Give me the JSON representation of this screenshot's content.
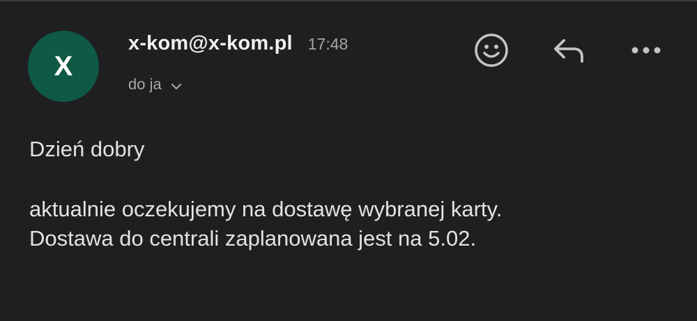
{
  "sender": {
    "avatar_letter": "X",
    "avatar_color": "#0f5a45",
    "address": "x-kom@x-kom.pl",
    "time": "17:48",
    "recipient_text": "do ja"
  },
  "actions": [
    {
      "name": "emoji-reaction",
      "icon": "smiley-icon"
    },
    {
      "name": "reply",
      "icon": "reply-arrow-icon"
    },
    {
      "name": "more-options",
      "icon": "more-horizontal-icon"
    }
  ],
  "message": {
    "greeting": "Dzień dobry",
    "lines": [
      "aktualnie oczekujemy na dostawę wybranej karty.",
      "Dostawa do centrali zaplanowana jest na 5.02."
    ]
  }
}
